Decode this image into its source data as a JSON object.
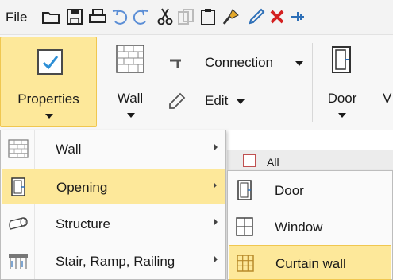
{
  "qat": {
    "file_label": "File",
    "icons": [
      "open-folder-icon",
      "save-icon",
      "print-icon",
      "undo-icon",
      "redo-icon",
      "cut-icon",
      "copy-icon",
      "paste-icon",
      "format-painter-icon",
      "eyedropper-icon",
      "delete-icon",
      "dimension-icon"
    ]
  },
  "ribbon": {
    "properties_label": "Properties",
    "wall_label": "Wall",
    "connection_label": "Connection",
    "edit_label": "Edit",
    "door_label": "Door",
    "truncated_label": "V"
  },
  "background": {
    "tab_label": "All"
  },
  "menu": {
    "items": [
      {
        "label": "Wall",
        "icon": "wall-icon"
      },
      {
        "label": "Opening",
        "icon": "opening-icon"
      },
      {
        "label": "Structure",
        "icon": "structure-icon"
      },
      {
        "label": "Stair, Ramp, Railing",
        "icon": "stair-ramp-railing-icon"
      }
    ],
    "active_index": 1
  },
  "submenu": {
    "items": [
      {
        "label": "Door",
        "icon": "door-icon"
      },
      {
        "label": "Window",
        "icon": "window-icon"
      },
      {
        "label": "Curtain wall",
        "icon": "curtain-wall-icon"
      }
    ],
    "active_index": 2
  },
  "colors": {
    "highlight": "#fde89a",
    "highlight_border": "#f0c750",
    "icon_blue": "#2d6fb7",
    "delete_red": "#d42020"
  }
}
